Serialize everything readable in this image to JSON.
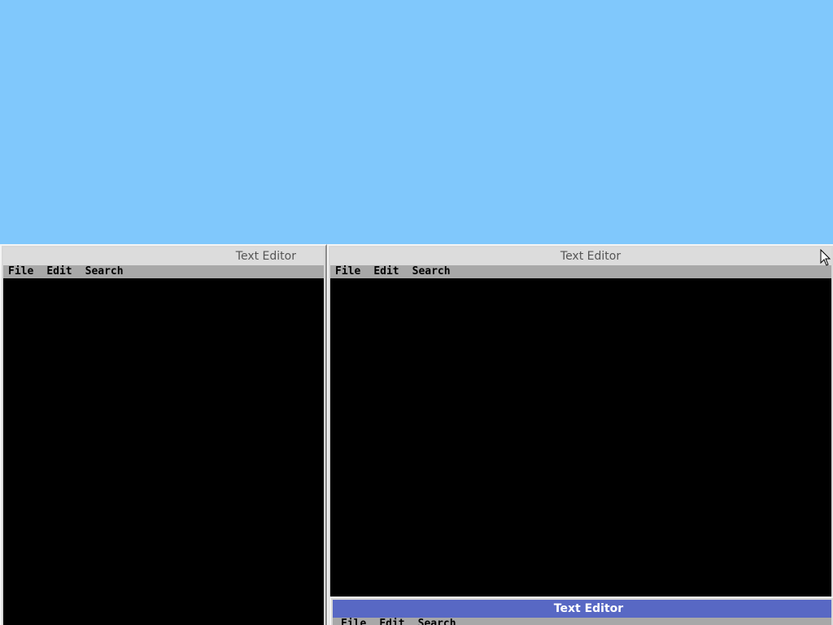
{
  "windows": [
    {
      "title": "Text Editor",
      "menu": [
        "File",
        "Edit",
        "Search"
      ]
    },
    {
      "title": "Text Editor",
      "menu": [
        "File",
        "Edit",
        "Search"
      ]
    },
    {
      "title": "Text Editor",
      "menu": [
        "File",
        "Edit",
        "Search"
      ],
      "active": true
    }
  ],
  "colors": {
    "desktop": "#80c8fc",
    "active_title": "#5868c4",
    "inactive_title": "#dcdcdc",
    "menubar": "#a8a8a8",
    "editor_bg": "#000000"
  },
  "icons": {
    "pointer": "mouse-pointer-icon"
  }
}
